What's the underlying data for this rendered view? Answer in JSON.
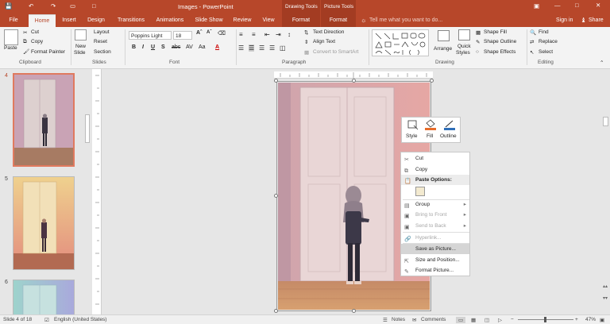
{
  "titlebar": {
    "document_title": "Images - PowerPoint",
    "contextual_drawing": "Drawing Tools",
    "contextual_picture": "Picture Tools",
    "sign_in": "Sign in",
    "share": "Share"
  },
  "tabs": [
    {
      "label": "File"
    },
    {
      "label": "Home"
    },
    {
      "label": "Insert"
    },
    {
      "label": "Design"
    },
    {
      "label": "Transitions"
    },
    {
      "label": "Animations"
    },
    {
      "label": "Slide Show"
    },
    {
      "label": "Review"
    },
    {
      "label": "View"
    },
    {
      "label": "Format"
    },
    {
      "label": "Format"
    }
  ],
  "tell_me": "Tell me what you want to do...",
  "ribbon": {
    "clipboard": {
      "paste": "Paste",
      "cut": "Cut",
      "copy": "Copy",
      "format_painter": "Format Painter",
      "label": "Clipboard"
    },
    "slides": {
      "new_slide": "New",
      "new_slide2": "Slide",
      "layout": "Layout",
      "reset": "Reset",
      "section": "Section",
      "label": "Slides"
    },
    "font": {
      "name": "Poppins Light",
      "size": "18",
      "label": "Font"
    },
    "paragraph": {
      "text_direction": "Text Direction",
      "align_text": "Align Text",
      "convert_smartart": "Convert to SmartArt",
      "label": "Paragraph"
    },
    "drawing": {
      "arrange": "Arrange",
      "quick_styles": "Quick",
      "quick_styles2": "Styles",
      "shape_fill": "Shape Fill",
      "shape_outline": "Shape Outline",
      "shape_effects": "Shape Effects",
      "label": "Drawing"
    },
    "editing": {
      "find": "Find",
      "replace": "Replace",
      "select": "Select",
      "label": "Editing"
    }
  },
  "thumbnails": [
    {
      "number": "4"
    },
    {
      "number": "5"
    },
    {
      "number": "6"
    }
  ],
  "mini_toolbar": {
    "style": "Style",
    "fill": "Fill",
    "outline": "Outline"
  },
  "context_menu": {
    "cut": "Cut",
    "copy": "Copy",
    "paste_options": "Paste Options:",
    "group": "Group",
    "bring_to_front": "Bring to Front",
    "send_to_back": "Send to Back",
    "hyperlink": "Hyperlink...",
    "save_as_picture": "Save as Picture...",
    "size_position": "Size and Position...",
    "format_picture": "Format Picture..."
  },
  "status": {
    "slide_info": "Slide 4 of 18",
    "language": "English (United States)",
    "notes": "Notes",
    "comments": "Comments",
    "zoom": "47%"
  },
  "colors": {
    "accent": "#b7472a",
    "context_tab": "#a33c22"
  }
}
